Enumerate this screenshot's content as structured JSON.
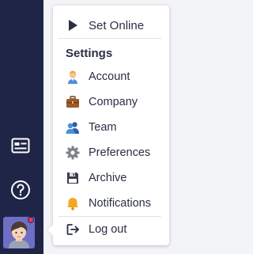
{
  "menu": {
    "set_online": "Set Online",
    "heading": "Settings",
    "items": [
      {
        "label": "Account",
        "icon": "account-icon"
      },
      {
        "label": "Company",
        "icon": "briefcase-icon"
      },
      {
        "label": "Team",
        "icon": "team-icon"
      },
      {
        "label": "Preferences",
        "icon": "gear-icon"
      },
      {
        "label": "Archive",
        "icon": "floppy-disk-icon"
      },
      {
        "label": "Notifications",
        "icon": "bell-icon"
      }
    ],
    "logout": "Log out"
  },
  "sidebar": {
    "icons": [
      "id-card-icon",
      "help-icon",
      "avatar"
    ],
    "has_notification_dot": true
  },
  "colors": {
    "sidebar_bg": "#1e2547",
    "avatar_bg": "#6e6fc4",
    "notification_dot": "#e8336b",
    "text": "#2a2f45"
  }
}
